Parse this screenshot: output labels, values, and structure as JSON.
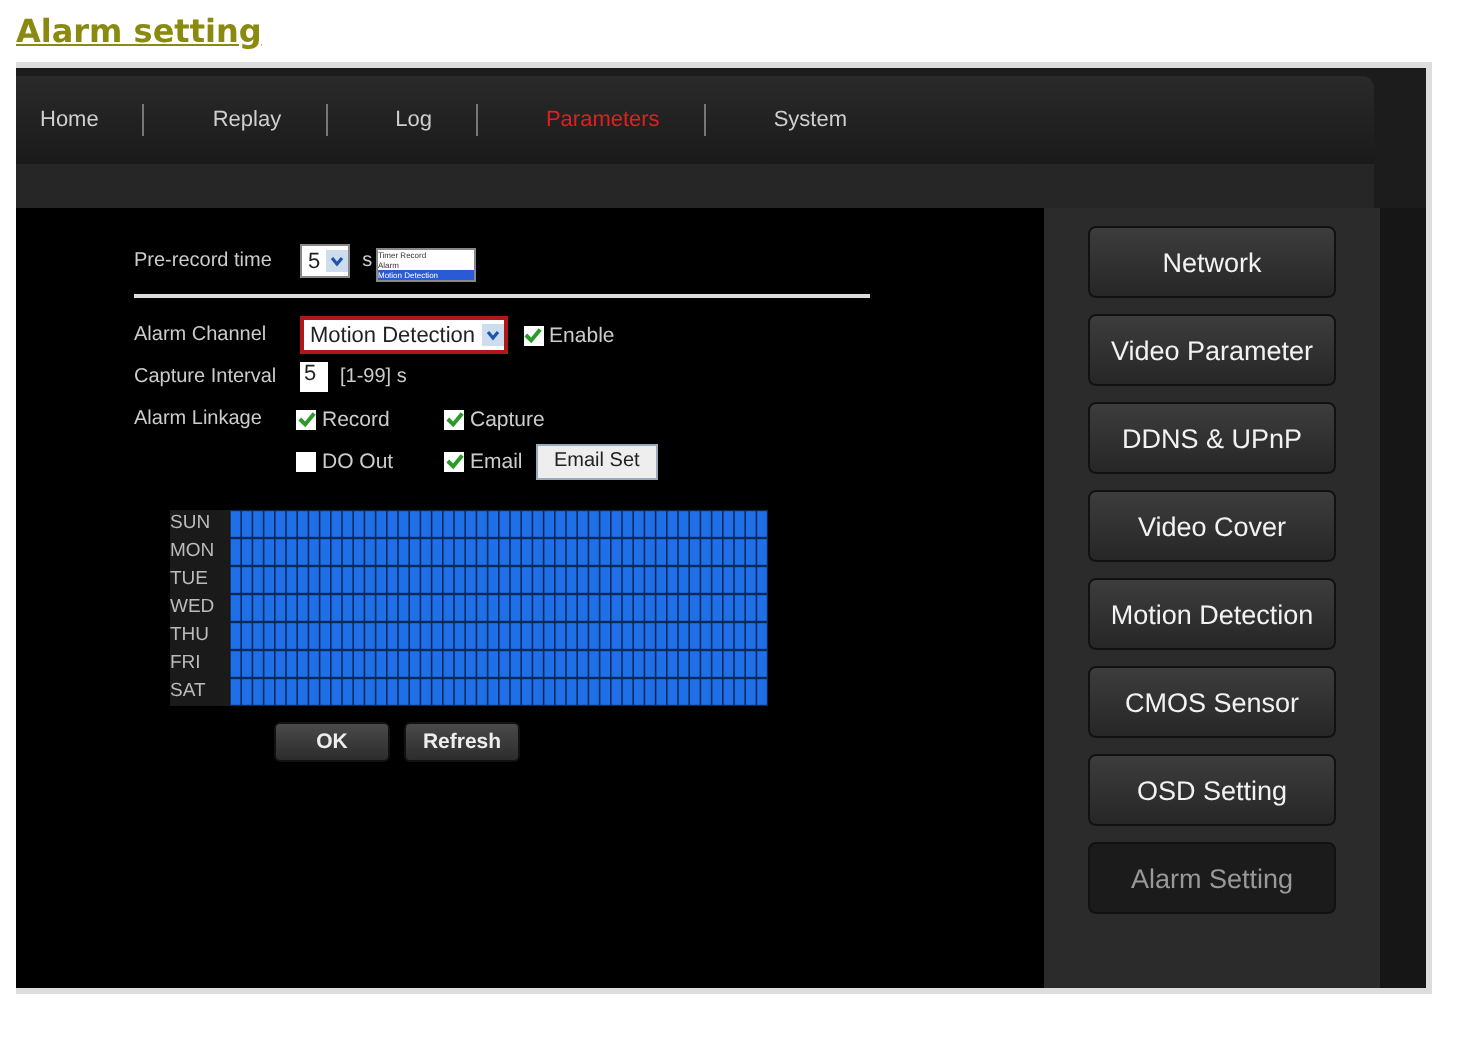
{
  "heading": "Alarm setting",
  "nav": [
    {
      "label": "Home",
      "selected": false
    },
    {
      "label": "Replay",
      "selected": false
    },
    {
      "label": "Log",
      "selected": false
    },
    {
      "label": "Parameters",
      "selected": true
    },
    {
      "label": "System",
      "selected": false
    }
  ],
  "pre_record": {
    "label": "Pre-record time",
    "value": "5",
    "unit": "s"
  },
  "channel_menu": [
    {
      "label": "Timer Record",
      "selected": false
    },
    {
      "label": "Alarm",
      "selected": false
    },
    {
      "label": "Motion Detection",
      "selected": true
    }
  ],
  "alarm_channel": {
    "label": "Alarm Channel",
    "value": "Motion Detection",
    "enable": {
      "label": "Enable",
      "checked": true
    }
  },
  "capture_interval": {
    "label": "Capture Interval",
    "value": "5",
    "hint": "[1-99] s"
  },
  "linkage": {
    "label": "Alarm Linkage",
    "options": [
      {
        "label": "Record",
        "checked": true
      },
      {
        "label": "Capture",
        "checked": true
      },
      {
        "label": "DO Out",
        "checked": false
      },
      {
        "label": "Email",
        "checked": true
      }
    ],
    "email_button": "Email Set"
  },
  "schedule": [
    {
      "day": "SUN",
      "armed": true
    },
    {
      "day": "MON",
      "armed": true
    },
    {
      "day": "TUE",
      "armed": true
    },
    {
      "day": "WED",
      "armed": true
    },
    {
      "day": "THU",
      "armed": true
    },
    {
      "day": "FRI",
      "armed": true
    },
    {
      "day": "SAT",
      "armed": true
    }
  ],
  "buttons": [
    "OK",
    "Refresh"
  ],
  "sidebar": [
    {
      "label": "Network",
      "selected": false
    },
    {
      "label": "Video Parameter",
      "selected": false
    },
    {
      "label": "DDNS & UPnP",
      "selected": false
    },
    {
      "label": "Video Cover",
      "selected": false
    },
    {
      "label": "Motion Detection",
      "selected": false
    },
    {
      "label": "CMOS Sensor",
      "selected": false
    },
    {
      "label": "OSD Setting",
      "selected": false
    },
    {
      "label": "Alarm Setting",
      "selected": true
    }
  ]
}
